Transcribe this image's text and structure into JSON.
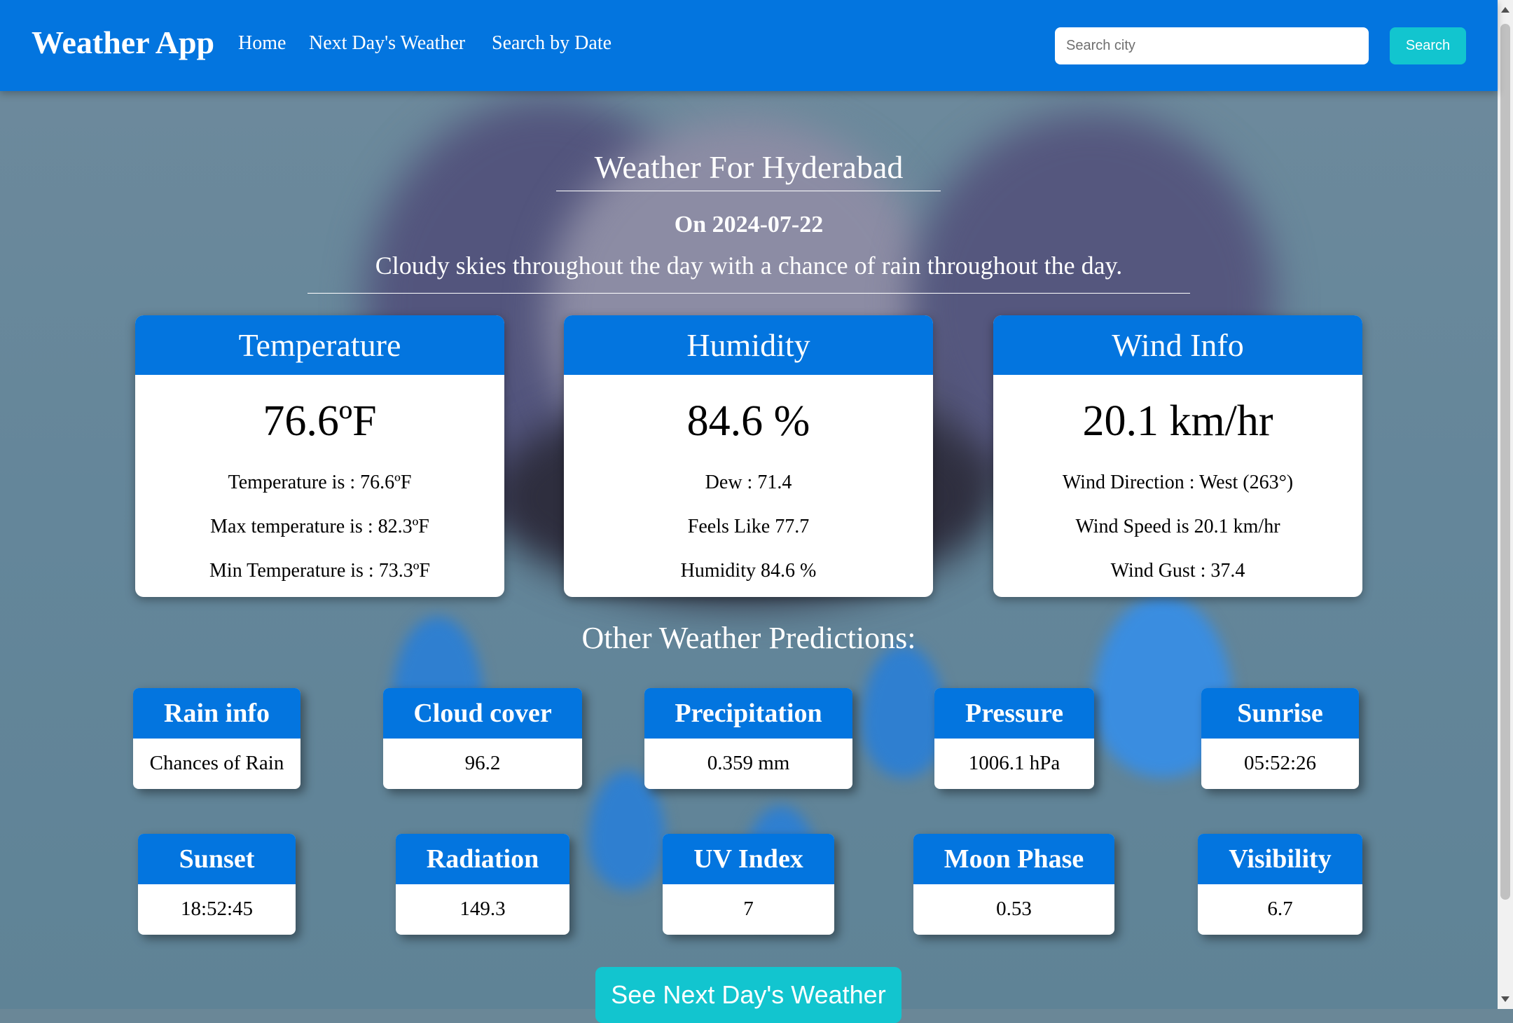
{
  "navbar": {
    "brand": "Weather App",
    "links": [
      "Home",
      "Next Day's Weather",
      "Search by Date"
    ],
    "search_placeholder": "Search city",
    "search_button": "Search"
  },
  "header": {
    "title": "Weather For Hyderabad",
    "date": "On 2024-07-22",
    "description": "Cloudy skies throughout the day with a chance of rain throughout the day."
  },
  "cards": [
    {
      "title": "Temperature",
      "main": "76.6ºF",
      "lines": [
        "Temperature is : 76.6ºF",
        "Max temperature is : 82.3ºF",
        "Min Temperature is : 73.3ºF"
      ]
    },
    {
      "title": "Humidity",
      "main": "84.6 %",
      "lines": [
        "Dew : 71.4",
        "Feels Like 77.7",
        "Humidity 84.6 %"
      ]
    },
    {
      "title": "Wind Info",
      "main": "20.1 km/hr",
      "lines": [
        "Wind Direction : West (263°)",
        "Wind Speed is 20.1 km/hr",
        "Wind Gust : 37.4"
      ]
    }
  ],
  "other_heading": "Other Weather Predictions:",
  "predictions": [
    {
      "label": "Rain info",
      "value": "Chances of Rain"
    },
    {
      "label": "Cloud cover",
      "value": "96.2"
    },
    {
      "label": "Precipitation",
      "value": "0.359 mm"
    },
    {
      "label": "Pressure",
      "value": "1006.1 hPa"
    },
    {
      "label": "Sunrise",
      "value": "05:52:26"
    },
    {
      "label": "Sunset",
      "value": "18:52:45"
    },
    {
      "label": "Radiation",
      "value": "149.3"
    },
    {
      "label": "UV Index",
      "value": "7"
    },
    {
      "label": "Moon Phase",
      "value": "0.53"
    },
    {
      "label": "Visibility",
      "value": "6.7"
    }
  ],
  "cta_button": "See Next Day's Weather",
  "colors": {
    "primary": "#0375df",
    "accent": "#12c5cf"
  }
}
